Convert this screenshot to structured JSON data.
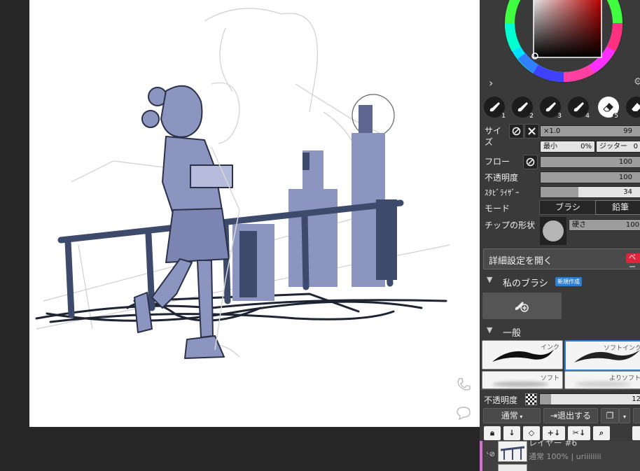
{
  "colors": {
    "ink_fill": "#8c95c0",
    "ink_dark": "#3e4a6c",
    "panel_bg": "#3a3a3a",
    "accent_blue": "#2f7fd0",
    "badge_red": "#e0253a"
  },
  "brush_presets": [
    {
      "num": "1",
      "icon": "brush-icon"
    },
    {
      "num": "2",
      "icon": "brush-icon"
    },
    {
      "num": "3",
      "icon": "brush-icon"
    },
    {
      "num": "4",
      "icon": "brush-icon"
    },
    {
      "num": "5",
      "icon": "eraser-icon",
      "active": true
    }
  ],
  "brush_settings": {
    "size_label": "サイズ",
    "size_multiplier": "×1.0",
    "size_value": "99",
    "min_label": "最小",
    "min_value": "0%",
    "jitter_label": "ジッター",
    "jitter_value": "0",
    "flow_label": "フロー",
    "flow_value": "100",
    "opacity_label": "不透明度",
    "opacity_value": "100",
    "stabilizer_label": "ｽﾀﾋﾞﾗｲｻﾞｰ",
    "stabilizer_value": "34",
    "mode_label": "モード",
    "mode_brush": "ブラシ",
    "mode_pencil": "鉛筆",
    "tip_label": "チップの形状",
    "hardness_label": "硬さ",
    "hardness_value": "100",
    "advanced_label": "詳細設定を開く",
    "advanced_badge": "ベー"
  },
  "my_brushes": {
    "title": "私のブラシ",
    "new_badge": "新規作成"
  },
  "general": {
    "title": "一般",
    "cards": [
      "インク",
      "ソフトインク",
      "ソフト",
      "よりソフト"
    ]
  },
  "layer_controls": {
    "opacity_label": "不透明度",
    "opacity_value": "12",
    "blend_mode": "通常",
    "exit_label": "退出する"
  },
  "layer": {
    "name": "レイヤー #6",
    "meta": "通常 100% | uriiiiiiii"
  }
}
